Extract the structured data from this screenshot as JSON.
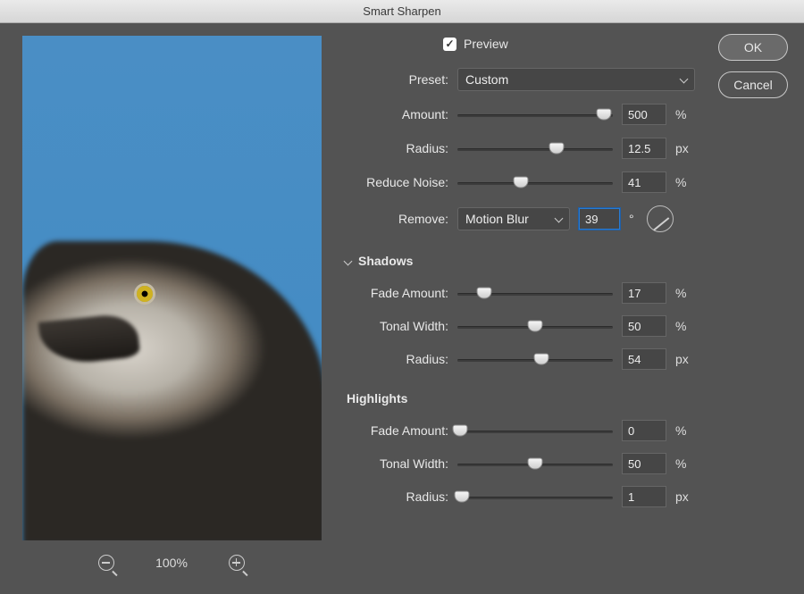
{
  "title": "Smart Sharpen",
  "buttons": {
    "ok": "OK",
    "cancel": "Cancel"
  },
  "preview": {
    "label": "Preview",
    "checked": true
  },
  "zoom": {
    "level": "100%"
  },
  "preset": {
    "label": "Preset:",
    "value": "Custom"
  },
  "amount": {
    "label": "Amount:",
    "value": "500",
    "unit": "%",
    "pos": 94
  },
  "radius": {
    "label": "Radius:",
    "value": "12.5",
    "unit": "px",
    "pos": 64
  },
  "reduce_noise": {
    "label": "Reduce Noise:",
    "value": "41",
    "unit": "%",
    "pos": 41
  },
  "remove": {
    "label": "Remove:",
    "value": "Motion Blur",
    "angle_value": "39",
    "angle_unit": "°"
  },
  "shadows": {
    "title": "Shadows",
    "fade": {
      "label": "Fade Amount:",
      "value": "17",
      "unit": "%",
      "pos": 17
    },
    "tonal": {
      "label": "Tonal Width:",
      "value": "50",
      "unit": "%",
      "pos": 50
    },
    "radius": {
      "label": "Radius:",
      "value": "54",
      "unit": "px",
      "pos": 54
    }
  },
  "highlights": {
    "title": "Highlights",
    "fade": {
      "label": "Fade Amount:",
      "value": "0",
      "unit": "%",
      "pos": 2
    },
    "tonal": {
      "label": "Tonal Width:",
      "value": "50",
      "unit": "%",
      "pos": 50
    },
    "radius": {
      "label": "Radius:",
      "value": "1",
      "unit": "px",
      "pos": 3
    }
  }
}
